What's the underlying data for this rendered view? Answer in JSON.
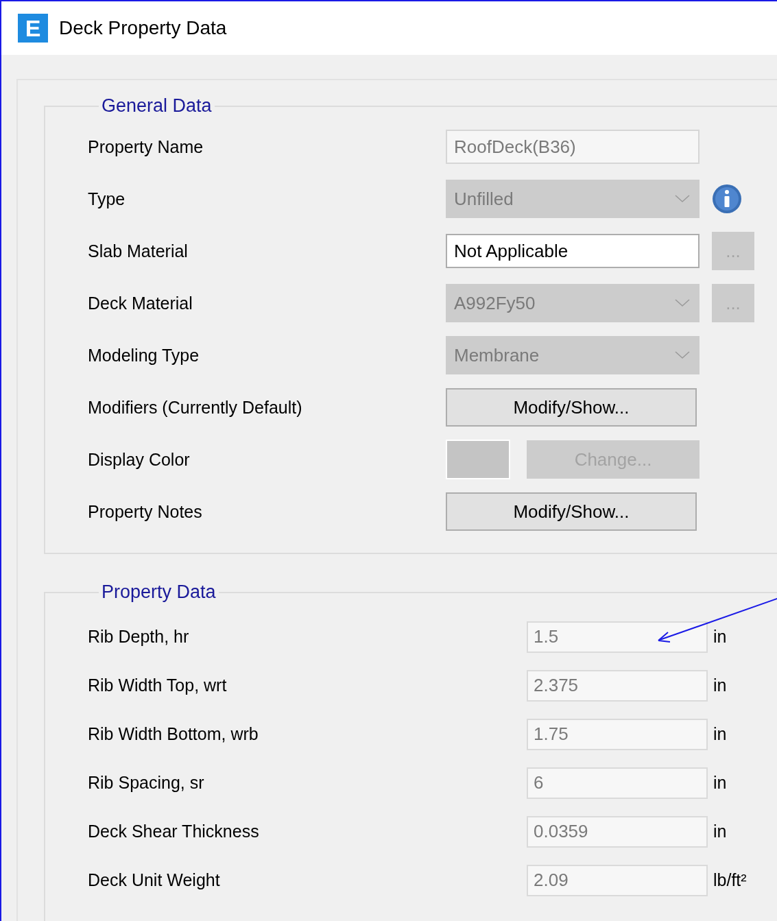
{
  "window": {
    "title": "Deck Property Data",
    "icon": "E"
  },
  "general_data": {
    "title": "General Data",
    "rows": [
      {
        "label": "Property Name",
        "kind": "text",
        "value": "RoofDeck(B36)",
        "disabled": true
      },
      {
        "label": "Type",
        "kind": "dropdown",
        "value": "Unfilled",
        "disabled": true,
        "info": true
      },
      {
        "label": "Slab Material",
        "kind": "text",
        "value": "Not Applicable",
        "disabled": false,
        "side_button": {
          "label": "...",
          "disabled": true
        }
      },
      {
        "label": "Deck Material",
        "kind": "dropdown",
        "value": "A992Fy50",
        "disabled": true,
        "side_button": {
          "label": "...",
          "disabled": true
        }
      },
      {
        "label": "Modeling Type",
        "kind": "dropdown",
        "value": "Membrane",
        "disabled": true
      },
      {
        "label": "Modifiers (Currently Default)",
        "kind": "button",
        "value": "Modify/Show...",
        "disabled": false
      },
      {
        "label": "Display Color",
        "kind": "color",
        "value": "Change...",
        "disabled": true
      },
      {
        "label": "Property Notes",
        "kind": "button",
        "value": "Modify/Show...",
        "disabled": false
      }
    ]
  },
  "property_data": {
    "title": "Property Data",
    "rows": [
      {
        "label": "Rib Depth, hr",
        "value": "1.5",
        "unit": "in"
      },
      {
        "label": "Rib Width Top, wrt",
        "value": "2.375",
        "unit": "in"
      },
      {
        "label": "Rib Width Bottom, wrb",
        "value": "1.75",
        "unit": "in"
      },
      {
        "label": "Rib Spacing, sr",
        "value": "6",
        "unit": "in"
      },
      {
        "label": "Deck Shear Thickness",
        "value": "0.0359",
        "unit": "in"
      },
      {
        "label": "Deck Unit Weight",
        "value": "2.09",
        "unit": "lb/ft²"
      }
    ]
  }
}
